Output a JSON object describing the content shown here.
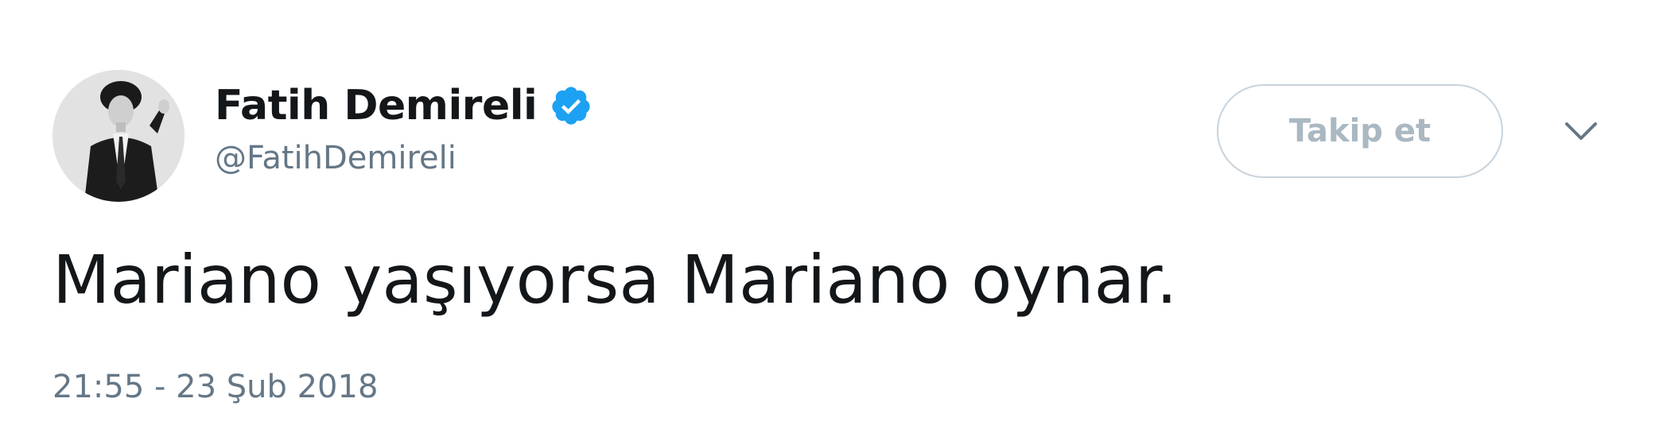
{
  "author": {
    "display_name": "Fatih Demireli",
    "handle": "@FatihDemireli",
    "verified": true,
    "avatar_icon": "profile-photo"
  },
  "actions": {
    "follow_label": "Takip et",
    "menu_icon": "chevron-down-icon"
  },
  "tweet": {
    "text": "Mariano yaşıyorsa Mariano oynar.",
    "timestamp": "21:55 - 23 Şub 2018"
  },
  "colors": {
    "name": "#14171a",
    "secondary": "#657786",
    "verified": "#1da1f2",
    "follow_border": "#c8d3dc",
    "follow_text": "#aab8c2"
  }
}
